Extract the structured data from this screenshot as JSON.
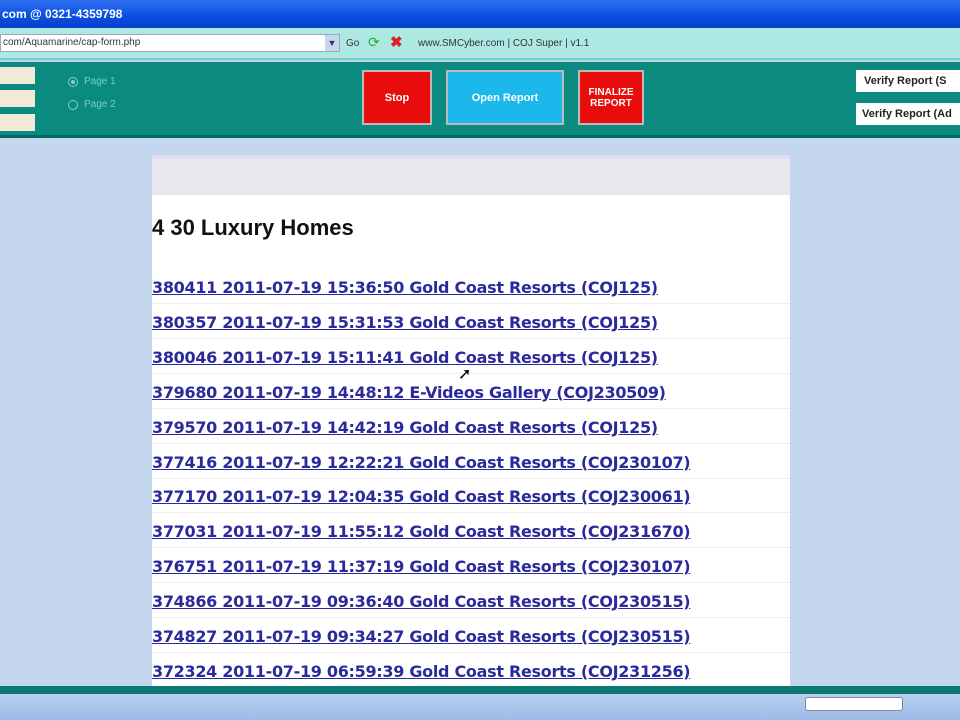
{
  "window": {
    "title": "com @ 0321-4359798"
  },
  "address": {
    "url": "com/Aquamarine/cap-form.php",
    "go_label": "Go",
    "site_info": "www.SMCyber.com | COJ Super | v1.1"
  },
  "toolbar": {
    "radios": [
      {
        "label": "Page 1",
        "checked": true
      },
      {
        "label": "Page 2",
        "checked": false
      }
    ],
    "stop_label": "Stop",
    "open_report_label": "Open Report",
    "finalize_label": "FINALIZE REPORT",
    "verify1_label": "Verify Report (S",
    "verify2_label": "Verify Report (Ad",
    "colors": {
      "stop": "#e80c0c",
      "open": "#1cb8ec",
      "finalize": "#e80c0c",
      "teal": "#0b8a80"
    }
  },
  "content": {
    "heading": "4 30 Luxury Homes",
    "links": [
      "380411 2011-07-19 15:36:50 Gold Coast Resorts (COJ125)",
      "380357 2011-07-19 15:31:53 Gold Coast Resorts (COJ125)",
      "380046 2011-07-19 15:11:41 Gold Coast Resorts (COJ125)",
      "379680 2011-07-19 14:48:12 E-Videos Gallery (COJ230509)",
      "379570 2011-07-19 14:42:19 Gold Coast Resorts (COJ125)",
      "377416 2011-07-19 12:22:21 Gold Coast Resorts (COJ230107)",
      "377170 2011-07-19 12:04:35 Gold Coast Resorts (COJ230061)",
      "377031 2011-07-19 11:55:12 Gold Coast Resorts (COJ231670)",
      "376751 2011-07-19 11:37:19 Gold Coast Resorts (COJ230107)",
      "374866 2011-07-19 09:36:40 Gold Coast Resorts (COJ230515)",
      "374827 2011-07-19 09:34:27 Gold Coast Resorts (COJ230515)",
      "372324 2011-07-19 06:59:39 Gold Coast Resorts (COJ231256)"
    ]
  }
}
